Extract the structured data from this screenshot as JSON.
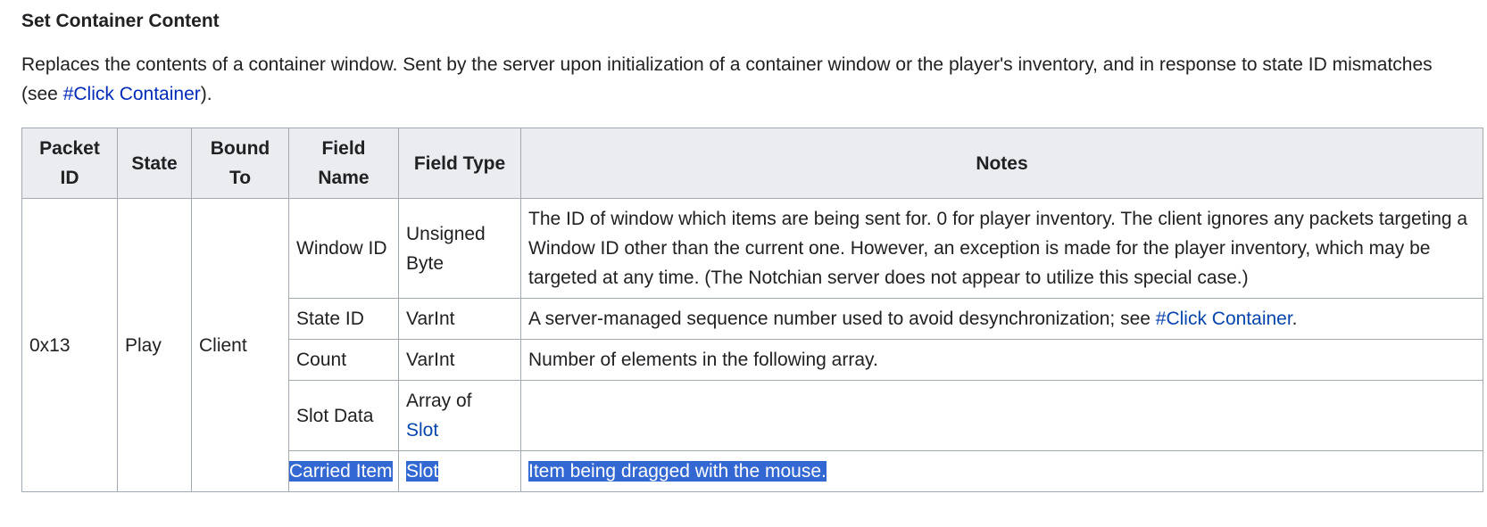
{
  "section": {
    "title": "Set Container Content",
    "description_before": "Replaces the contents of a container window. Sent by the server upon initialization of a container window or the player's inventory, and in response to state ID mismatches (see ",
    "description_link": "#Click Container",
    "description_after": ")."
  },
  "table": {
    "headers": {
      "packet_id": "Packet ID",
      "state": "State",
      "bound_to": "Bound To",
      "field_name": "Field Name",
      "field_type": "Field Type",
      "notes": "Notes"
    },
    "packet_id": "0x13",
    "state": "Play",
    "bound_to": "Client",
    "rows": [
      {
        "field_name": "Window ID",
        "field_type": "Unsigned Byte",
        "notes": "The ID of window which items are being sent for. 0 for player inventory. The client ignores any packets targeting a Window ID other than the current one. However, an exception is made for the player inventory, which may be targeted at any time. (The Notchian server does not appear to utilize this special case.)"
      },
      {
        "field_name": "State ID",
        "field_type": "VarInt",
        "notes_before": "A server-managed sequence number used to avoid desynchronization; see ",
        "notes_link": "#Click Container",
        "notes_after": "."
      },
      {
        "field_name": "Count",
        "field_type": "VarInt",
        "notes": "Number of elements in the following array."
      },
      {
        "field_name": "Slot Data",
        "field_type_prefix": "Array of",
        "field_type_link": "Slot",
        "notes": ""
      },
      {
        "field_name": "Carried Item",
        "field_type": "Slot",
        "notes": "Item being dragged with the mouse.",
        "selected": true
      }
    ]
  },
  "colors": {
    "link": "#0645ad",
    "header_bg": "#eaecf0",
    "border": "#a2a9b1",
    "selection": "#3367d1"
  }
}
